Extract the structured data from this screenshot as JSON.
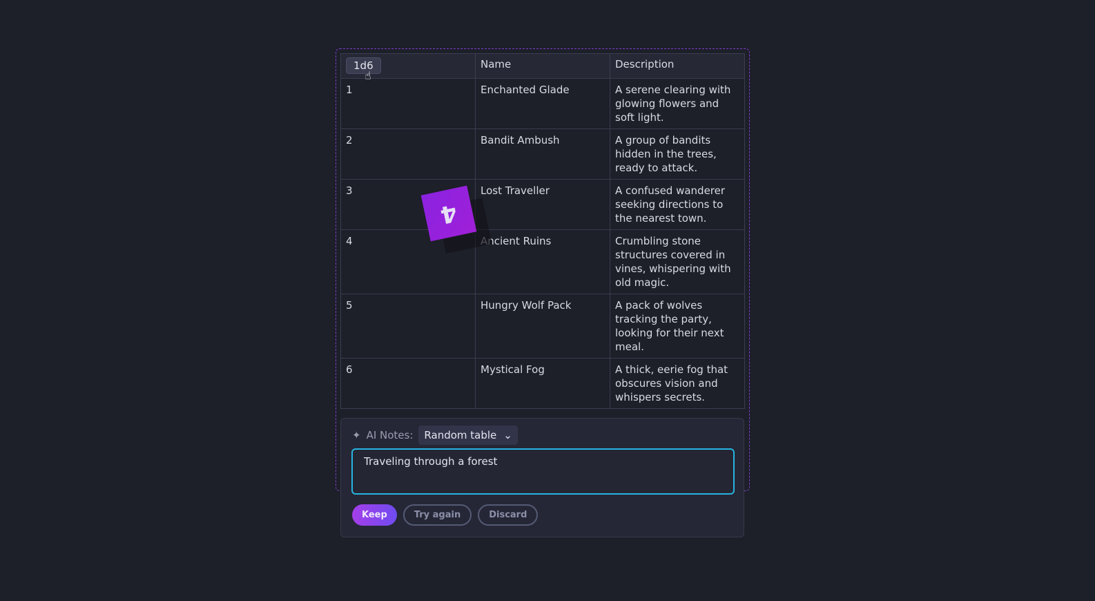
{
  "table": {
    "headers": [
      "1d6",
      "Name",
      "Description"
    ],
    "rows": [
      {
        "roll": "1",
        "name": "Enchanted Glade",
        "description": "A serene clearing with glowing flowers and soft light."
      },
      {
        "roll": "2",
        "name": "Bandit Ambush",
        "description": "A group of bandits hidden in the trees, ready to attack."
      },
      {
        "roll": "3",
        "name": "Lost Traveller",
        "description": "A confused wanderer seeking directions to the nearest town."
      },
      {
        "roll": "4",
        "name": "Ancient Ruins",
        "description": "Crumbling stone structures covered in vines, whispering with old magic."
      },
      {
        "roll": "5",
        "name": "Hungry Wolf Pack",
        "description": "A pack of wolves tracking the party, looking for their next meal."
      },
      {
        "roll": "6",
        "name": "Mystical Fog",
        "description": "A thick, eerie fog that obscures vision and whispers secrets."
      }
    ]
  },
  "die": {
    "value": "4",
    "color": "#9a22dc"
  },
  "notes": {
    "label": "AI Notes:",
    "mode": "Random table",
    "prompt": "Traveling through a forest",
    "accent": "#26b4e0"
  },
  "buttons": {
    "keep": "Keep",
    "try_again": "Try again",
    "discard": "Discard"
  }
}
